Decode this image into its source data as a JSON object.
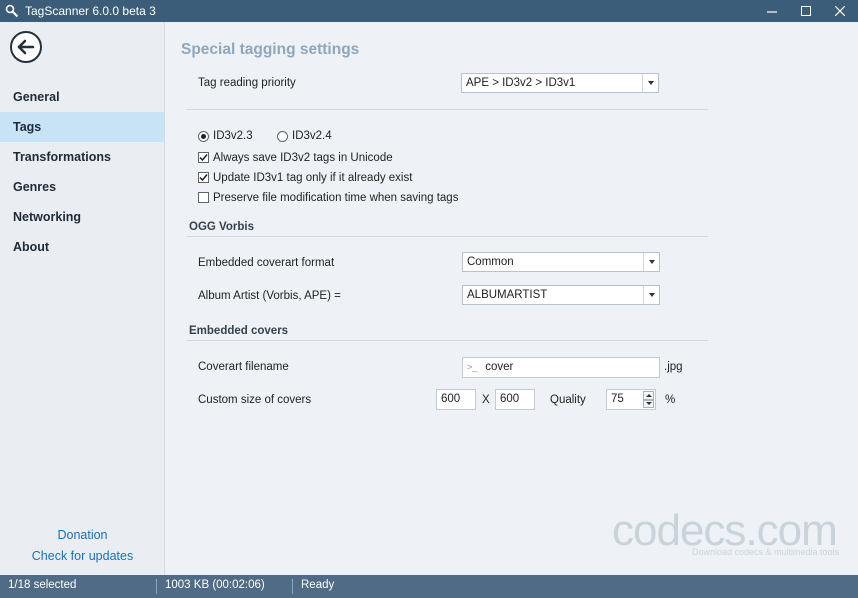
{
  "window": {
    "title": "TagScanner 6.0.0 beta 3"
  },
  "sidebar": {
    "items": [
      {
        "label": "General"
      },
      {
        "label": "Tags"
      },
      {
        "label": "Transformations"
      },
      {
        "label": "Genres"
      },
      {
        "label": "Networking"
      },
      {
        "label": "About"
      }
    ],
    "active_item": "Tags",
    "donation_label": "Donation",
    "updates_label": "Check for updates"
  },
  "page": {
    "title": "Special tagging settings",
    "tag_priority": {
      "label": "Tag reading priority",
      "value": "APE > ID3v2 > ID3v1"
    },
    "id3_version": {
      "options": [
        "ID3v2.3",
        "ID3v2.4"
      ],
      "selected": "ID3v2.3"
    },
    "checkboxes": [
      {
        "label": "Always save ID3v2 tags in Unicode",
        "checked": true
      },
      {
        "label": "Update ID3v1 tag only if it already exist",
        "checked": true
      },
      {
        "label": "Preserve file modification time when saving tags",
        "checked": false
      }
    ],
    "ogg": {
      "section_title": "OGG Vorbis",
      "coverart_format": {
        "label": "Embedded coverart format",
        "value": "Common"
      },
      "album_artist": {
        "label": "Album Artist (Vorbis, APE) =",
        "value": "ALBUMARTIST"
      }
    },
    "covers": {
      "section_title": "Embedded covers",
      "filename": {
        "label": "Coverart filename",
        "prefix": ">_",
        "value": "cover",
        "extension": ".jpg"
      },
      "custom_size": {
        "label": "Custom size of covers",
        "width": "600",
        "separator": "X",
        "height": "600",
        "quality_label": "Quality",
        "quality": "75",
        "quality_unit": "%"
      }
    }
  },
  "watermark": {
    "text": "codecs.com",
    "subtext": "Download codecs & multimedia tools"
  },
  "statusbar": {
    "selection": "1/18 selected",
    "size": "1003 KB (00:02:06)",
    "state": "Ready"
  },
  "colors": {
    "titlebar": "#3b5d7a",
    "statusbar": "#4f6b85",
    "active_nav": "#c8e2f6",
    "link": "#1c6fb8",
    "page_title": "#8fa7bd"
  }
}
